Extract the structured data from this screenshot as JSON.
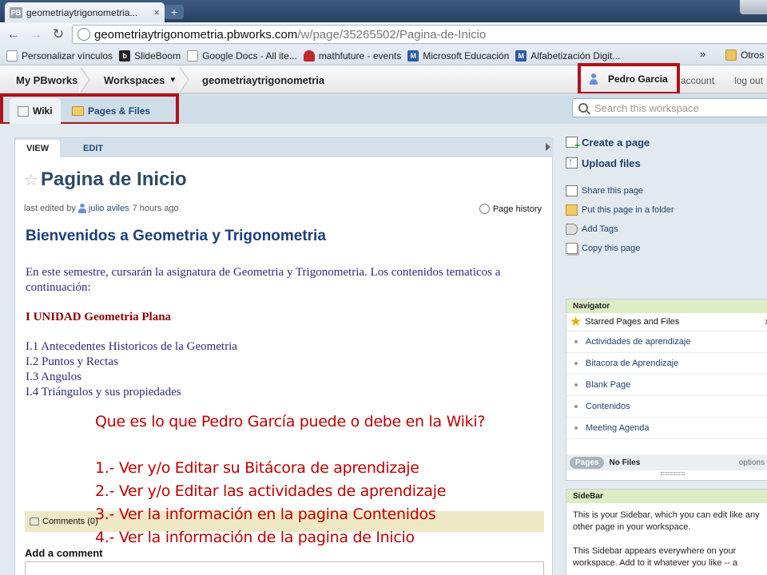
{
  "browser": {
    "tab_title": "geometriaytrigonometria...",
    "tab_favicon": "PB",
    "new_tab": "+",
    "url_host": "geometriaytrigonometria.pbworks.com",
    "url_path": "/w/page/35265502/Pagina-de-Inicio",
    "bookmarks": [
      {
        "label": "Personalizar vínculos",
        "icon": "page-icon"
      },
      {
        "label": "SlideBoom",
        "icon": "slideboom-icon"
      },
      {
        "label": "Google Docs - All ite...",
        "icon": "google-docs-icon"
      },
      {
        "label": "mathfuture - events",
        "icon": "mathfuture-icon"
      },
      {
        "label": "Microsoft Educación",
        "icon": "microsoft-icon"
      },
      {
        "label": "Alfabetización Digit...",
        "icon": "microsoft-icon"
      }
    ],
    "bookmarks_more": "»",
    "bookmarks_other": "Otros m"
  },
  "pbtop": {
    "brand": "My PBworks",
    "workspaces": "Workspaces",
    "workspace_name": "geometriaytrigonometria",
    "user": "Pedro Garcia",
    "account": "account",
    "logout": "log out"
  },
  "subbar": {
    "tab_wiki": "Wiki",
    "tab_pages": "Pages & Files",
    "search_placeholder": "Search this workspace"
  },
  "page": {
    "tab_view": "VIEW",
    "tab_edit": "EDIT",
    "title": "Pagina de Inicio",
    "last_edited_prefix": "last edited by",
    "last_edited_user": "julio aviles",
    "last_edited_time": "7 hours ago",
    "page_history": "Page history",
    "heading": "Bienvenidos a Geometria y Trigonometria",
    "intro": "En este semestre, cursarán la asignatura de Geometria y Trigonometria. Los contenidos tematicos a continuación:",
    "unit": "I UNIDAD  Geometria Plana",
    "topics": [
      "I.1 Antecedentes Historicos de la Geometria",
      "I.2 Puntos y Rectas",
      "I.3 Angulos",
      "I.4 Triángulos y sus propiedades"
    ],
    "comments": "Comments (0)",
    "add_comment": "Add a comment"
  },
  "overlay": {
    "question": "Que es lo que Pedro García puede o debe en la Wiki?",
    "items": [
      "1.- Ver y/o  Editar su Bitácora de aprendizaje",
      "2.- Ver y/o  Editar las actividades de aprendizaje",
      "3.- Ver la información en la pagina Contenidos",
      "4.- Ver la información de la pagina de Inicio"
    ],
    "color": "#c00000"
  },
  "actions": {
    "create_page": "Create a page",
    "upload_files": "Upload files",
    "share": "Share this page",
    "folder": "Put this page in a folder",
    "tags": "Add Tags",
    "copy": "Copy this page"
  },
  "navigator": {
    "header": "Navigator",
    "starred": "Starred Pages and Files",
    "close": "x",
    "items": [
      "Actividades de aprendizaje",
      "Bitacora de Aprendizaje",
      "Blank Page",
      "Contenidos",
      "Meeting Agenda"
    ],
    "pages_btn": "Pages",
    "no_files": "No Files",
    "options": "options"
  },
  "sidebar": {
    "header": "SideBar",
    "text1": "This is your Sidebar, which you can edit like any other page in your workspace.",
    "text2": "This Sidebar appears everywhere on your workspace. Add to it whatever you like -- a"
  },
  "colors": {
    "highlight_border": "#b01218",
    "page_title": "#2c4a64",
    "link": "#1f3f6a"
  }
}
